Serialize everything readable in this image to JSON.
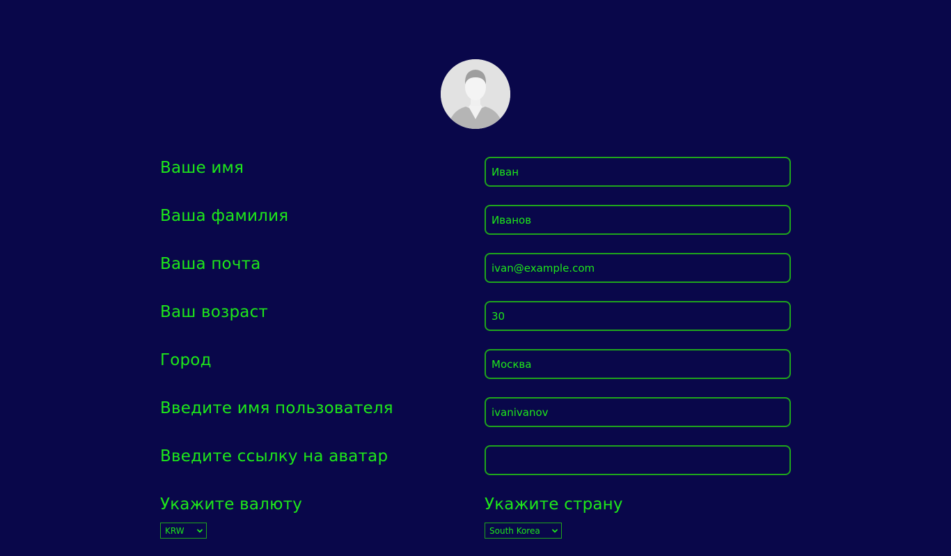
{
  "profile": {
    "avatar": "default-user-avatar"
  },
  "form": {
    "fields": [
      {
        "label": "Ваше имя",
        "value": "Иван"
      },
      {
        "label": "Ваша фамилия",
        "value": "Иванов"
      },
      {
        "label": "Ваша почта",
        "value": "ivan@example.com"
      },
      {
        "label": "Ваш возраст",
        "value": "30"
      },
      {
        "label": "Город",
        "value": "Москва"
      },
      {
        "label": "Введите имя пользователя",
        "value": "ivanivanov"
      },
      {
        "label": "Введите ссылку на аватар",
        "value": ""
      }
    ],
    "currency": {
      "label": "Укажите валюту",
      "selected": "KRW"
    },
    "country": {
      "label": "Укажите страну",
      "selected": "South Korea"
    }
  },
  "colors": {
    "background": "#09074a",
    "accent": "#1ee81a",
    "border": "#1fa61c"
  }
}
